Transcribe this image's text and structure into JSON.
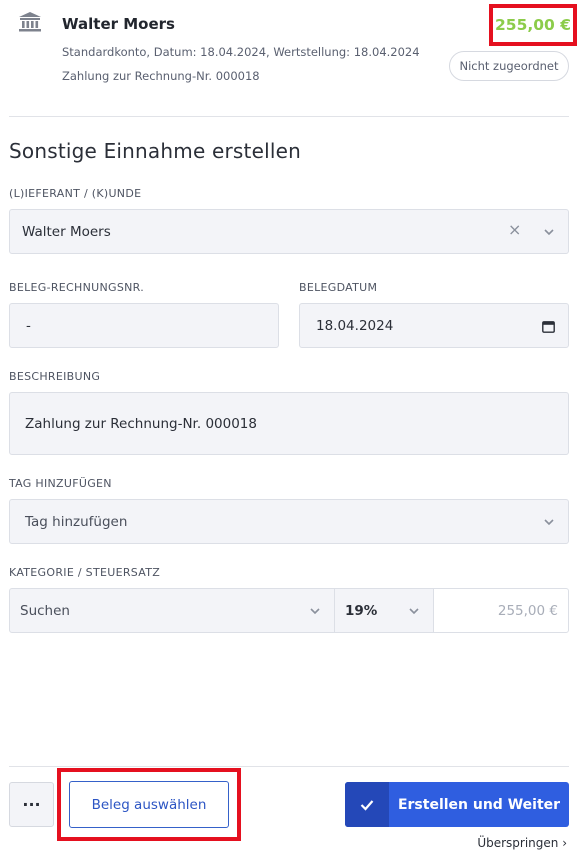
{
  "transaction": {
    "payer": "Walter Moers",
    "meta": "Standardkonto, Datum: 18.04.2024, Wertstellung: 18.04.2024",
    "reference": "Zahlung zur Rechnung-Nr. 000018",
    "amount": "255,00 €",
    "status": "Nicht zugeordnet",
    "icon": "bank-icon"
  },
  "form": {
    "title": "Sonstige Einnahme erstellen",
    "supplier_label": "(L)IEFERANT / (K)UNDE",
    "supplier_value": "Walter Moers",
    "invoice_label": "BELEG-RECHNUNGSNR.",
    "invoice_value": "-",
    "date_label": "BELEGDATUM",
    "date_value": "18.04.2024",
    "description_label": "BESCHREIBUNG",
    "description_value": "Zahlung zur Rechnung-Nr. 000018",
    "tag_label": "TAG HINZUFÜGEN",
    "tag_placeholder": "Tag hinzufügen",
    "category_label": "KATEGORIE / STEUERSATZ",
    "category_placeholder": "Suchen",
    "tax_rate": "19%",
    "category_amount": "255,00 €"
  },
  "actions": {
    "more": "···",
    "select_receipt": "Beleg auswählen",
    "submit": "Erstellen und Weiter",
    "skip": "Überspringen ›"
  },
  "colors": {
    "amount": "#8ccc4a",
    "highlight": "#e5101f",
    "primary": "#2f5ee0"
  }
}
